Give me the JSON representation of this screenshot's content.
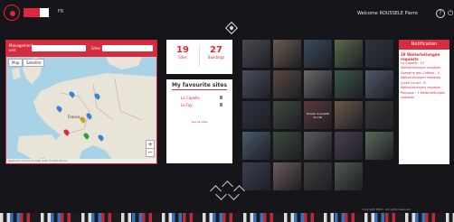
{
  "header": {
    "language": "FR",
    "welcome": "Welcome ROUSSELE Pierre",
    "help_glyph": "?",
    "power_glyph": "⏻"
  },
  "map_panel": {
    "management_unit_label": "Management unit",
    "sites_label": "Sites",
    "tab_map": "Map",
    "tab_satellite": "Satellite",
    "zoom_in": "+",
    "zoom_out": "−",
    "country_label": "France",
    "footer": "Keyboard shortcuts  Map data ©2024  Terms"
  },
  "stats": {
    "sites_value": "19",
    "sites_label": "Sites",
    "buildings_value": "27",
    "buildings_label": "Buildings"
  },
  "favourites": {
    "title": "My favourite sites",
    "items": [
      "La Capelle",
      "Le Fay"
    ],
    "more": "see all sites"
  },
  "tiles": [
    {
      "label": "",
      "color": "#4a4a50"
    },
    {
      "label": "",
      "color": "#6a5a50"
    },
    {
      "label": "",
      "color": "#3a4a5a"
    },
    {
      "label": "",
      "color": "#5a6a4a"
    },
    {
      "label": "",
      "color": "#2e3540"
    },
    {
      "label": "",
      "color": "#4a5060"
    },
    {
      "label": "",
      "color": "#5a4a40"
    },
    {
      "label": "",
      "color": "#6a6a6a"
    },
    {
      "label": "",
      "color": "#3a5a4a"
    },
    {
      "label": "",
      "color": "#505a6a"
    },
    {
      "label": "",
      "color": "#2e3440"
    },
    {
      "label": "",
      "color": "#404a40"
    },
    {
      "label": "Suivez la qualité de l'air",
      "color": "#5a3a3a"
    },
    {
      "label": "",
      "color": "#6a5a4a"
    },
    {
      "label": "",
      "color": "#3a3a3a"
    },
    {
      "label": "",
      "color": "#4a5a6a"
    },
    {
      "label": "",
      "color": "#3a4a3a"
    },
    {
      "label": "",
      "color": "#5a5a60"
    },
    {
      "label": "",
      "color": "#4a4050"
    },
    {
      "label": "",
      "color": "#5a6a5a"
    },
    {
      "label": "",
      "color": "#3a4050"
    },
    {
      "label": "",
      "color": "#6a5a5a"
    },
    {
      "label": "",
      "color": "#404040"
    },
    {
      "label": "",
      "color": "#505a50"
    }
  ],
  "notifications": {
    "title": "Notification",
    "summary": "29 Weiterleitungen requests",
    "items": [
      "La Capelle : 10 Weiterleitungen requests",
      "Domaine des Chênes : 4 Weiterleitungen requests",
      "Lycée Lurçat : 8 Weiterleitungen requests",
      "Pontoise : 7 Weiterleitungen requests"
    ]
  },
  "footer": {
    "text": "Copyright 2024 - All rights reserved"
  },
  "colors": {
    "accent": "#d72b3f",
    "background": "#15151a"
  }
}
